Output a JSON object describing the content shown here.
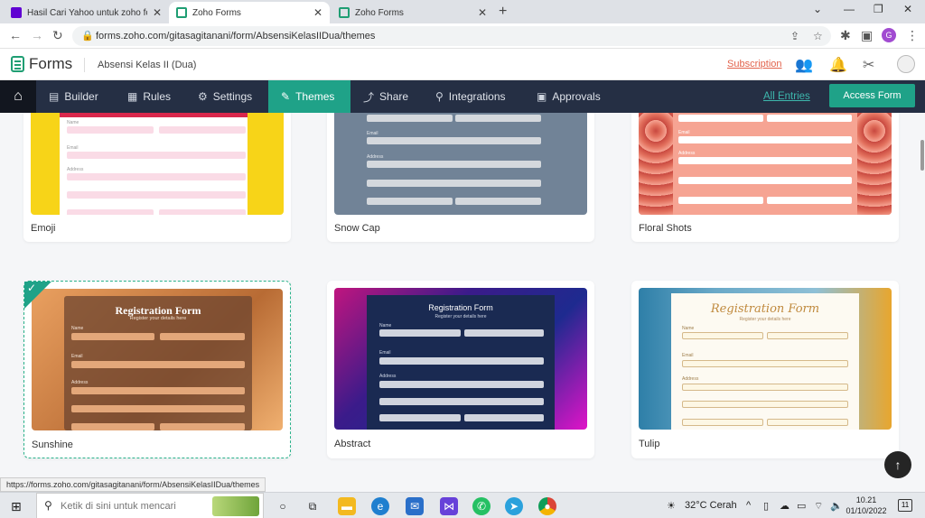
{
  "browser": {
    "tabs": [
      {
        "title": "Hasil Cari Yahoo untuk zoho form",
        "color": "#6001d2"
      },
      {
        "title": "Zoho Forms",
        "color": "#1f9e73"
      },
      {
        "title": "Zoho Forms",
        "color": "#1f9e73"
      }
    ],
    "url": "forms.zoho.com/gitasagitanani/form/AbsensiKelasIIDua/themes",
    "profile_initial": "G",
    "status_url": "https://forms.zoho.com/gitasagitanani/form/AbsensiKelasIIDua/themes"
  },
  "header": {
    "app_name": "Forms",
    "form_name": "Absensi Kelas II (Dua)",
    "subscription": "Subscription"
  },
  "nav": {
    "items": [
      {
        "label": "Builder",
        "icon": "builder-icon"
      },
      {
        "label": "Rules",
        "icon": "rules-icon"
      },
      {
        "label": "Settings",
        "icon": "gear-icon"
      },
      {
        "label": "Themes",
        "icon": "themes-icon"
      },
      {
        "label": "Share",
        "icon": "share-icon"
      },
      {
        "label": "Integrations",
        "icon": "integrations-icon"
      },
      {
        "label": "Approvals",
        "icon": "approvals-icon"
      }
    ],
    "active": "Themes",
    "all_entries": "All Entries",
    "access_form": "Access Form"
  },
  "themes": [
    {
      "name": "Emoji",
      "bg": "#f7d418",
      "form_bg": "#ffffff",
      "field": "#fadbe6",
      "accent": "#d9274c"
    },
    {
      "name": "Snow Cap",
      "bg": "#718397",
      "form_bg": "#718397",
      "field": "#d4d8dd",
      "accent": "#ffffff"
    },
    {
      "name": "Floral Shots",
      "bg": "#f2917a",
      "form_bg": "#f6a493",
      "field": "#ffffff",
      "accent": "#ffffff"
    },
    {
      "name": "Sunshine",
      "bg": "#d98b4f",
      "form_bg": "#8a5a3c",
      "field": "#e3a77a",
      "accent": "#ffffff",
      "selected": true,
      "title": "Registration Form",
      "subtitle": "Register your details here"
    },
    {
      "name": "Abstract",
      "bg": "#2b1b6b",
      "form_bg": "#1a2a52",
      "field": "#d0d4de",
      "accent": "#ffffff",
      "title": "Registration Form",
      "subtitle": "Register your details here"
    },
    {
      "name": "Tulip",
      "bg": "#4f8fb5",
      "form_bg": "#fdfaf2",
      "field": "#fdf7e4",
      "accent": "#c08a3e",
      "title": "Registration Form",
      "subtitle": "Register your details here"
    }
  ],
  "form_labels": {
    "name": "Name",
    "first": "First",
    "last": "Last",
    "email": "Email",
    "address": "Address",
    "street": "Street Address",
    "line2": "Address Line 2",
    "city": "City",
    "region": "State/Region/Province"
  },
  "taskbar": {
    "search_placeholder": "Ketik di sini untuk mencari",
    "weather": "32°C  Cerah",
    "time": "10.21",
    "date": "01/10/2022",
    "notifications": "11"
  }
}
